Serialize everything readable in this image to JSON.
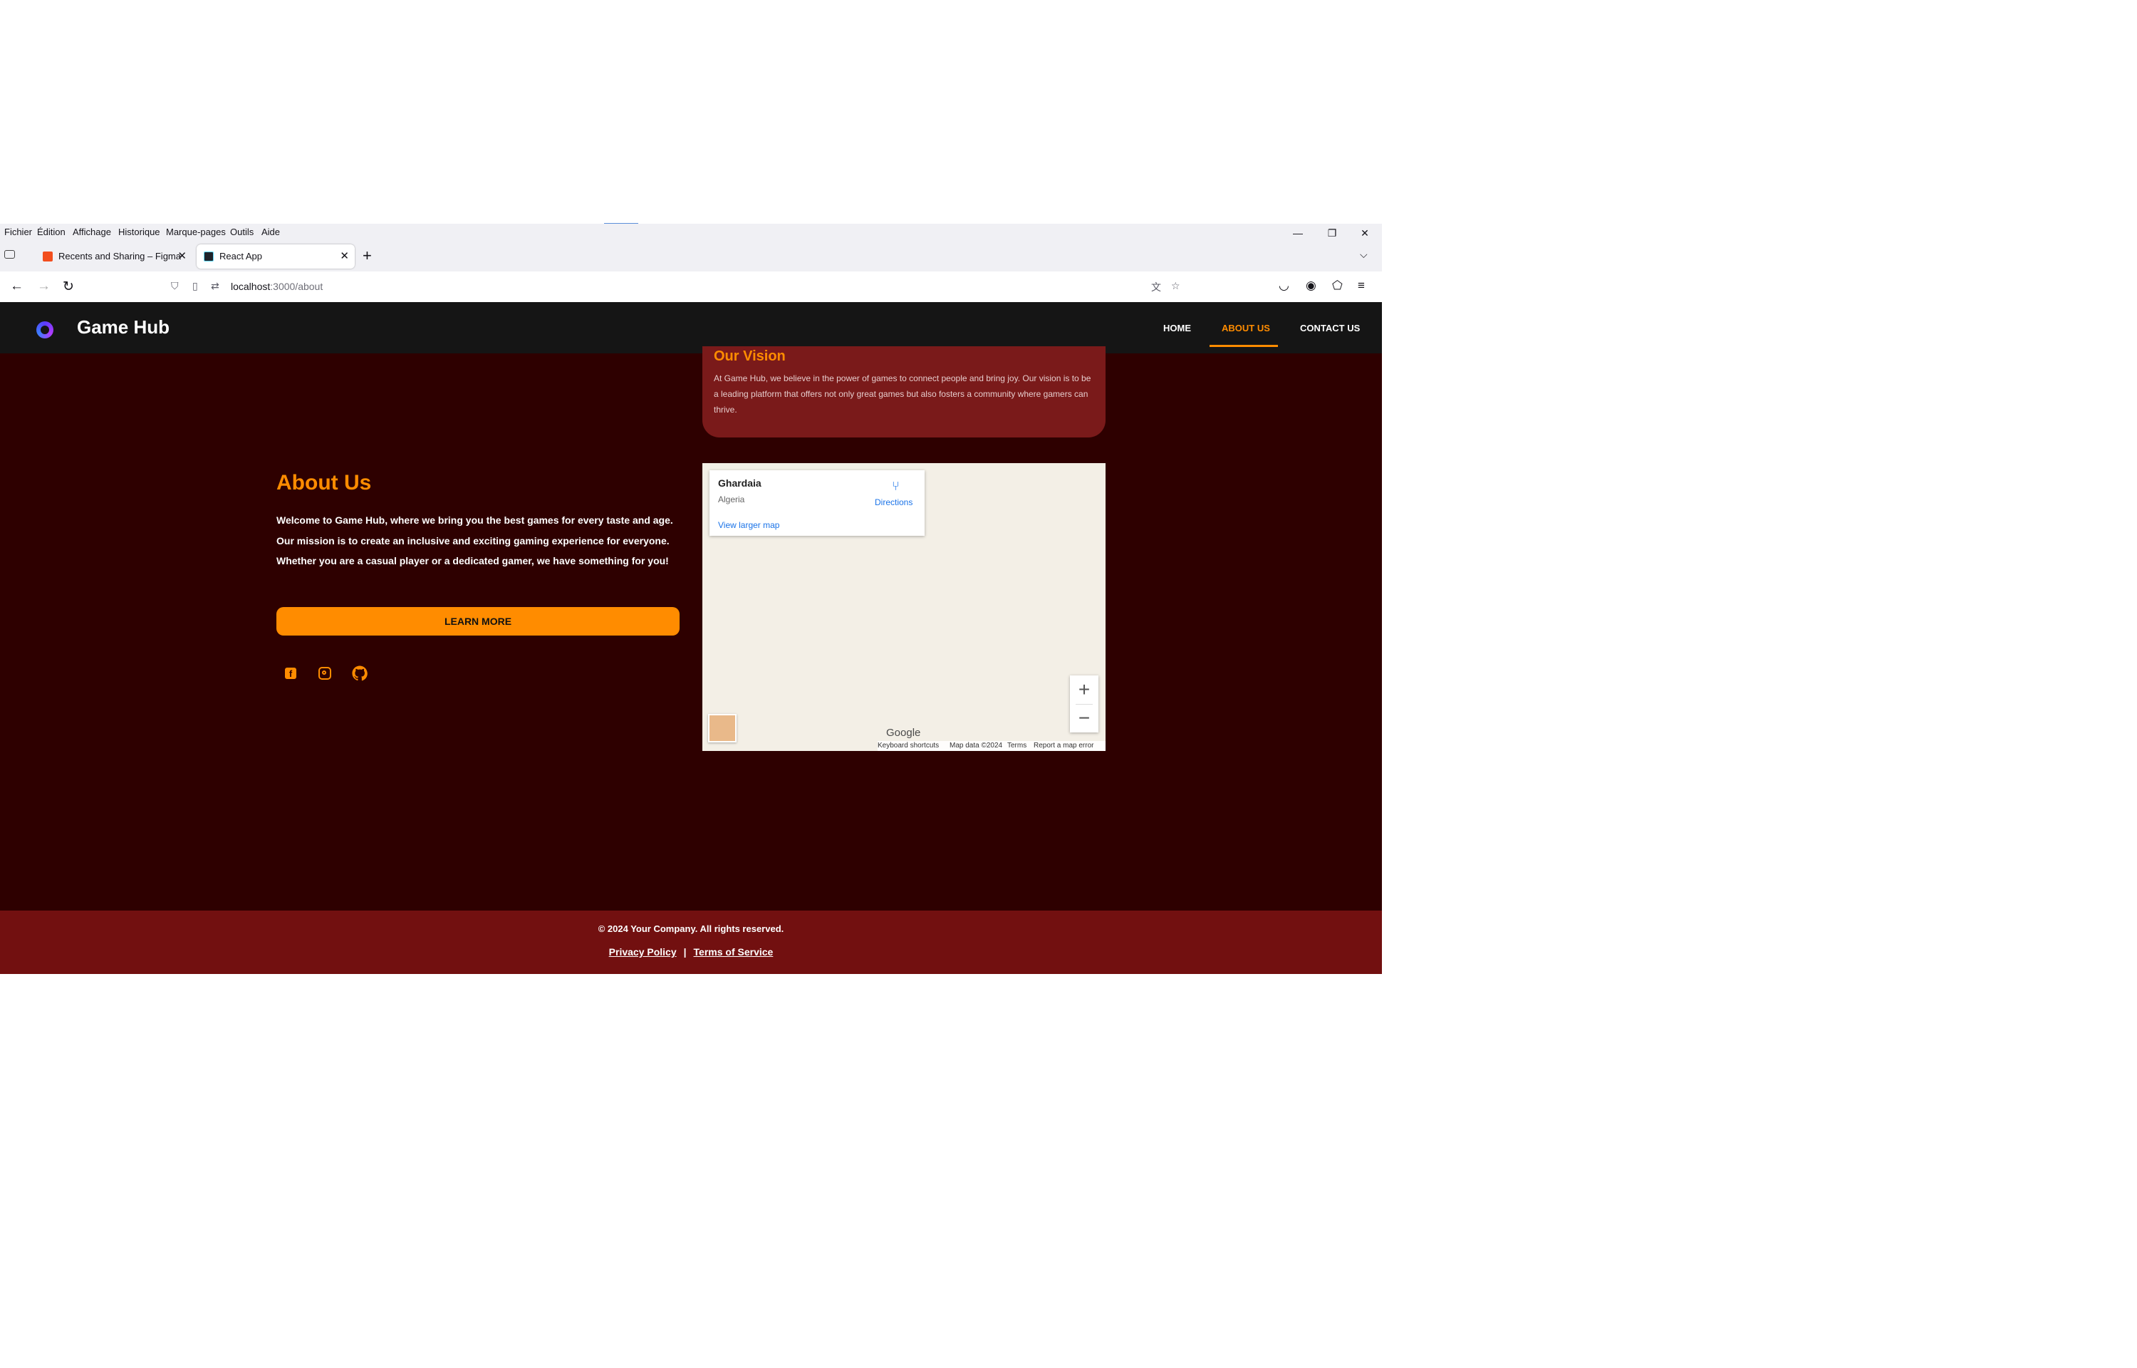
{
  "menu": {
    "items": [
      "Fichier",
      "Édition",
      "Affichage",
      "Historique",
      "Marque-pages",
      "Outils",
      "Aide"
    ]
  },
  "tabs": [
    {
      "title": "Recents and Sharing – Figma",
      "active": false,
      "favicon_color": "#f24e1e"
    },
    {
      "title": "React App",
      "active": true,
      "favicon_color": "#20232a"
    }
  ],
  "url": {
    "host": "localhost",
    "path": ":3000/about"
  },
  "site": {
    "brand": "Game Hub",
    "nav": [
      {
        "label": "HOME",
        "active": false
      },
      {
        "label": "ABOUT US",
        "active": true
      },
      {
        "label": "CONTACT US",
        "active": false
      }
    ],
    "accent_color": "#ff8c00"
  },
  "vision": {
    "title": "Our Vision",
    "text": "At Game Hub, we believe in the power of games to connect people and bring joy. Our vision is to be a leading platform that offers not only great games but also fosters a community where gamers can thrive."
  },
  "about": {
    "title": "About Us",
    "text": "Welcome to Game Hub, where we bring you the best games for every taste and age. Our mission is to create an inclusive and exciting gaming experience for everyone. Whether you are a casual player or a dedicated gamer, we have something for you!",
    "button": "LEARN MORE",
    "social_icons": [
      "facebook-icon",
      "instagram-icon",
      "github-icon"
    ]
  },
  "map": {
    "place": "Ghardaia",
    "country": "Algeria",
    "directions": "Directions",
    "larger_map": "View larger map",
    "zoom_in": "+",
    "zoom_out": "−",
    "logo": "Google",
    "footer": [
      "Keyboard shortcuts",
      "Map data ©2024",
      "Terms",
      "Report a map error"
    ]
  },
  "footer": {
    "copyright": "© 2024 Your Company. All rights reserved.",
    "privacy": "Privacy Policy",
    "separator": "|",
    "terms": "Terms of Service"
  }
}
